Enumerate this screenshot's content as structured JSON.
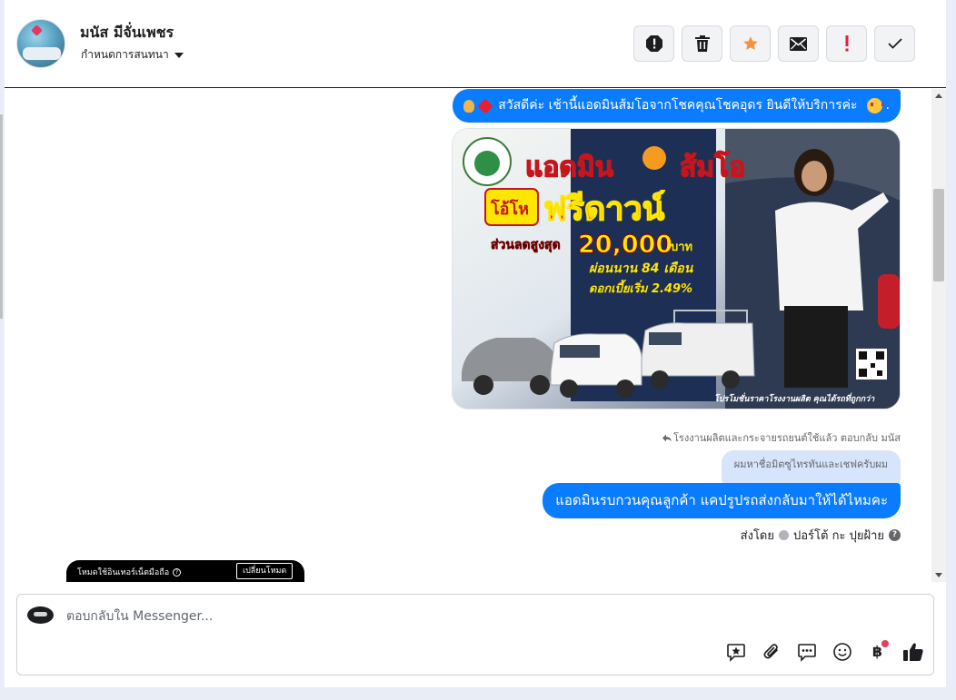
{
  "header": {
    "contact_name": "มนัส มีจั่นเพชร",
    "assign_label": "กำหนดการสนทนา",
    "tools": [
      {
        "name": "spam-icon",
        "symbol": "!"
      },
      {
        "name": "trash-icon"
      },
      {
        "name": "star-icon",
        "color": "#f7923a"
      },
      {
        "name": "mail-icon"
      },
      {
        "name": "important-icon",
        "symbol": "!",
        "color": "#e41e3f"
      },
      {
        "name": "done-check-icon"
      }
    ]
  },
  "messages": {
    "greeting": "สวัสดีค่ะ เช้านี้แอดมินส้มโอจากโชคคุณโชคอุดร ยินดีให้บริการค่ะ",
    "greeting_end": ".",
    "promo": {
      "brand_line": "แอดมิน",
      "brand_name": "ส้มโอ",
      "badge": "โอ้โห",
      "headline": "ฟรีดาวน์",
      "discount_label": "ส่วนลดสูงสุด",
      "discount_value": "20,000",
      "discount_unit": "บาท",
      "installment": "ผ่อนนาน 84 เดือน",
      "interest": "ดอกเบี้ยเริ่ม 2.49%",
      "footer": "โปรโมชั่นราคาโรงงานผลิต คุณได้รถที่ถูกกว่า"
    },
    "reply_meta": "โรงงานผลิตและกระจายรถยนต์ใช้แล้ว ตอบกลับ มนัส",
    "quoted_text": "ผมหาชื่อมิตซูไทรทันและเชฟครับผม",
    "reply_text": "แอดมินรบกวนคุณลูกค้า แคปรูปรถส่งกลับมาให้ได้ไหมคะ",
    "sent_by_label": "ส่งโดย",
    "sent_by_name": "ปอร์โต้ กะ ปุยฝ้าย",
    "help_symbol": "?"
  },
  "video_bar": {
    "text": "โหมดใช้อินเทอร์เน็ตมือถือ",
    "info_symbol": "?",
    "button": "เปลี่ยนโหมด"
  },
  "composer": {
    "placeholder": "ตอบกลับใน Messenger...",
    "tools": [
      "saved-reply-icon",
      "attachment-icon",
      "quick-reply-icon",
      "emoji-icon",
      "baht-payment-icon",
      "like-icon"
    ],
    "baht_symbol": "฿"
  },
  "colors": {
    "bubble_blue": "#0a7cff",
    "quoted_bg": "#d6e5fb",
    "star": "#f7923a",
    "important": "#e41e3f"
  }
}
